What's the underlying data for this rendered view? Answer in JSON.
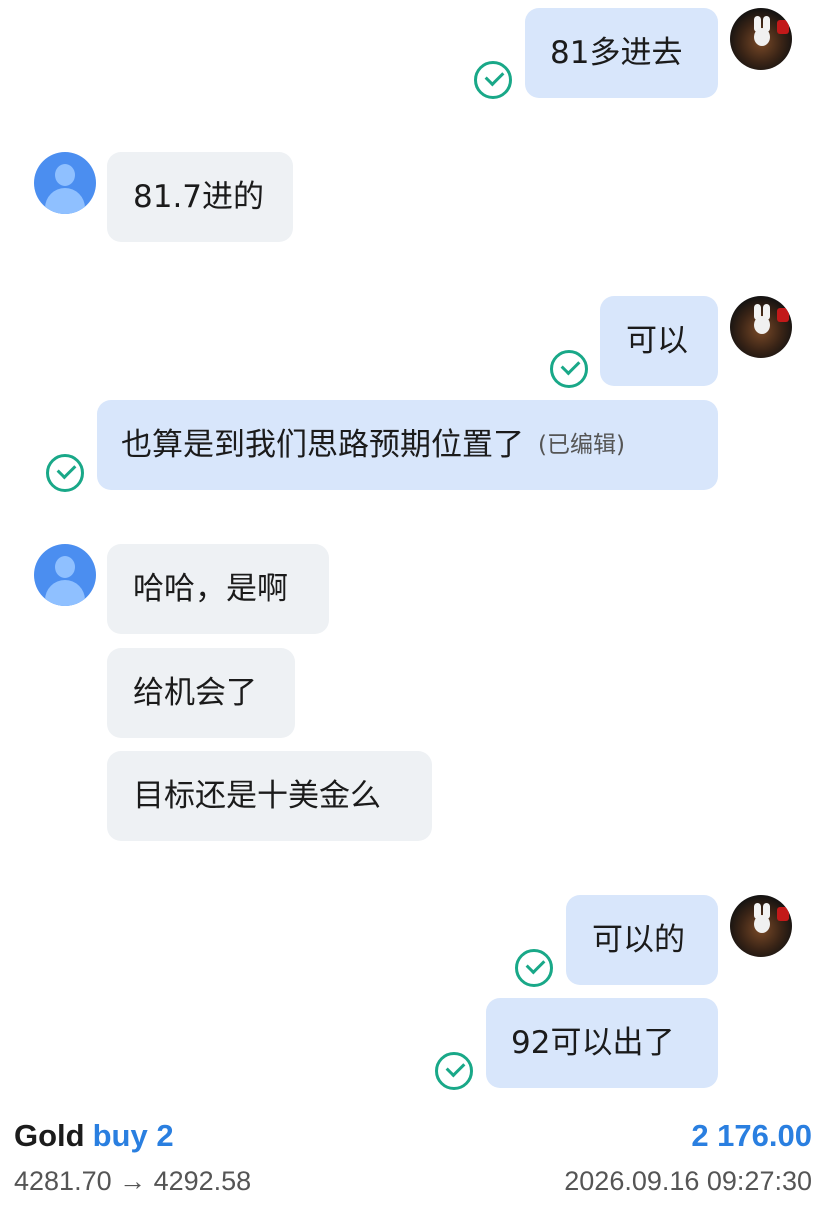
{
  "messages": [
    {
      "text": "81多进去"
    },
    {
      "text": "81.7进的"
    },
    {
      "text": "可以"
    },
    {
      "text": "也算是到我们思路预期位置了",
      "edited": "(已编辑)"
    },
    {
      "text": "哈哈，是啊"
    },
    {
      "text": "给机会了"
    },
    {
      "text": "目标还是十美金么"
    },
    {
      "text": "可以的"
    },
    {
      "text": "92可以出了"
    }
  ],
  "trade": {
    "symbol": "Gold",
    "direction": "buy 2",
    "profit": "2 176.00",
    "prices": "4281.70 → 4292.58",
    "time": "2026.09.16 09:27:30"
  },
  "colors": {
    "outgoing_bubble": "#d8e6fb",
    "incoming_bubble": "#eef1f4",
    "read_check": "#19a888",
    "accent_blue": "#2a7fe0"
  },
  "icons": {
    "read_receipt": "check-circle-icon",
    "self_avatar": "rabbit-avatar",
    "contact_avatar": "default-person-avatar"
  }
}
